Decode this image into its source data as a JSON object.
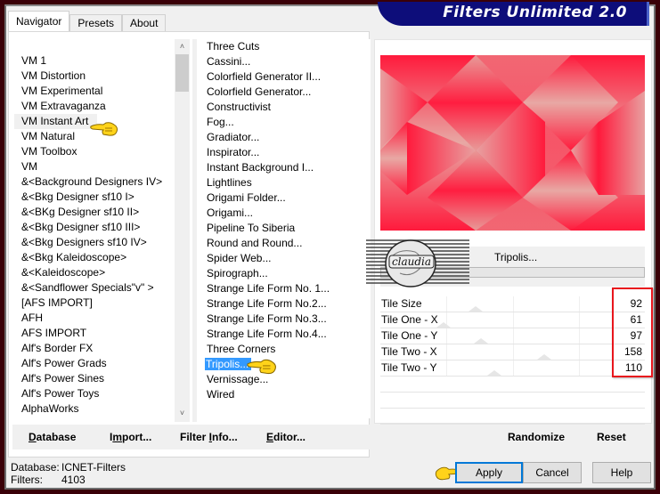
{
  "window": {
    "title": "Filters Unlimited 2.0",
    "frame_color": "#3a0008",
    "banner_color": "#0d0d7a"
  },
  "tabs": [
    {
      "label": "Navigator",
      "active": true
    },
    {
      "label": "Presets",
      "active": false
    },
    {
      "label": "About",
      "active": false
    }
  ],
  "categories": {
    "items": [
      "VM 1",
      "VM Distortion",
      "VM Experimental",
      "VM Extravaganza",
      "VM Instant Art",
      "VM Natural",
      "VM Toolbox",
      "VM",
      "&<Background Designers IV>",
      "&<Bkg Designer sf10 I>",
      "&<BKg Designer sf10 II>",
      "&<Bkg Designer sf10 III>",
      "&<Bkg Designers sf10 IV>",
      "&<Bkg Kaleidoscope>",
      "&<Kaleidoscope>",
      "&<Sandflower Specials\"v\" >",
      "[AFS IMPORT]",
      "AFH",
      "AFS IMPORT",
      "Alf's Border FX",
      "Alf's Power Grads",
      "Alf's Power Sines",
      "Alf's Power Toys",
      "AlphaWorks"
    ],
    "highlighted": "VM Instant Art",
    "scroll_up_icon": "chevron-up-icon",
    "scroll_down_icon": "chevron-down-icon"
  },
  "filters": {
    "items": [
      "Three Cuts",
      "Cassini...",
      "Colorfield Generator II...",
      "Colorfield Generator...",
      "Constructivist",
      "Fog...",
      "Gradiator...",
      "Inspirator...",
      "Instant Background I...",
      "Lightlines",
      "Origami Folder...",
      "Origami...",
      "Pipeline To Siberia",
      "Round and Round...",
      "Spider Web...",
      "Spirograph...",
      "Strange Life Form No. 1...",
      "Strange Life Form No.2...",
      "Strange Life Form No.3...",
      "Strange Life Form No.4...",
      "Three Corners",
      "Tripolis...",
      "Vernissage...",
      "Wired"
    ],
    "selected": "Tripolis...",
    "selected_color": "#3399ff"
  },
  "nav_buttons": {
    "database": {
      "pre": "",
      "u": "D",
      "post": "atabase"
    },
    "import": {
      "pre": "I",
      "u": "m",
      "post": "port..."
    },
    "filter_info": {
      "pre": "Filter ",
      "u": "I",
      "post": "nfo..."
    },
    "editor": {
      "pre": "",
      "u": "E",
      "post": "ditor..."
    }
  },
  "status": {
    "database_label": "Database:",
    "database_value": "ICNET-Filters",
    "filters_label": "Filters:",
    "filters_value": "4103"
  },
  "preview": {
    "filter_name": "Tripolis...",
    "watermark_text": "claudia"
  },
  "parameters": [
    {
      "name": "Tile Size",
      "value": "92",
      "fraction": 0.361
    },
    {
      "name": "Tile One - X",
      "value": "61",
      "fraction": 0.239
    },
    {
      "name": "Tile One - Y",
      "value": "97",
      "fraction": 0.38
    },
    {
      "name": "Tile Two - X",
      "value": "158",
      "fraction": 0.62
    },
    {
      "name": "Tile Two - Y",
      "value": "110",
      "fraction": 0.431
    }
  ],
  "param_highlight_color": "#e8161d",
  "right_buttons": {
    "randomize": "Randomize",
    "reset": "Reset"
  },
  "dialog_buttons": {
    "apply": "Apply",
    "cancel": "Cancel",
    "help": "Help"
  },
  "pointer_icons": [
    "hand-pointer-icon"
  ]
}
